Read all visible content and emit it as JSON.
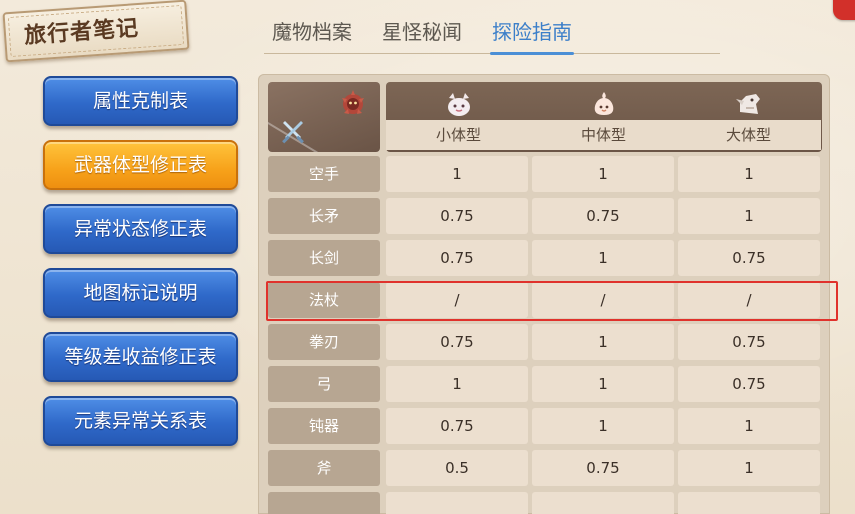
{
  "title": "旅行者笔记",
  "tabs": [
    {
      "label": "魔物档案",
      "active": false
    },
    {
      "label": "星怪秘闻",
      "active": false
    },
    {
      "label": "探险指南",
      "active": true
    }
  ],
  "menu": [
    {
      "label": "属性克制表",
      "active": false
    },
    {
      "label": "武器体型修正表",
      "active": true
    },
    {
      "label": "异常状态修正表",
      "active": false
    },
    {
      "label": "地图标记说明",
      "active": false
    },
    {
      "label": "等级差收益修正表",
      "active": false
    },
    {
      "label": "元素异常关系表",
      "active": false
    }
  ],
  "table": {
    "corner_icons": [
      "monster-emblem-icon",
      "crossed-swords-icon"
    ],
    "columns": [
      {
        "label": "小体型",
        "icon": "small-monster-icon"
      },
      {
        "label": "中体型",
        "icon": "medium-monster-icon"
      },
      {
        "label": "大体型",
        "icon": "large-monster-icon"
      }
    ],
    "rows": [
      {
        "weapon": "空手",
        "values": [
          "1",
          "1",
          "1"
        ]
      },
      {
        "weapon": "长矛",
        "values": [
          "0.75",
          "0.75",
          "1"
        ]
      },
      {
        "weapon": "长剑",
        "values": [
          "0.75",
          "1",
          "0.75"
        ]
      },
      {
        "weapon": "法杖",
        "values": [
          "/",
          "/",
          "/"
        ]
      },
      {
        "weapon": "拳刃",
        "values": [
          "0.75",
          "1",
          "0.75"
        ]
      },
      {
        "weapon": "弓",
        "values": [
          "1",
          "1",
          "0.75"
        ]
      },
      {
        "weapon": "钝器",
        "values": [
          "0.75",
          "1",
          "1"
        ]
      },
      {
        "weapon": "斧",
        "values": [
          "0.5",
          "0.75",
          "1"
        ]
      }
    ],
    "highlighted_row": "法杖"
  },
  "colors": {
    "tab_active": "#3c7fc9",
    "menu_blue": "#2f69c9",
    "menu_orange": "#f7a21a",
    "highlight_red": "#e0322c",
    "header_brown": "#6b5546"
  }
}
